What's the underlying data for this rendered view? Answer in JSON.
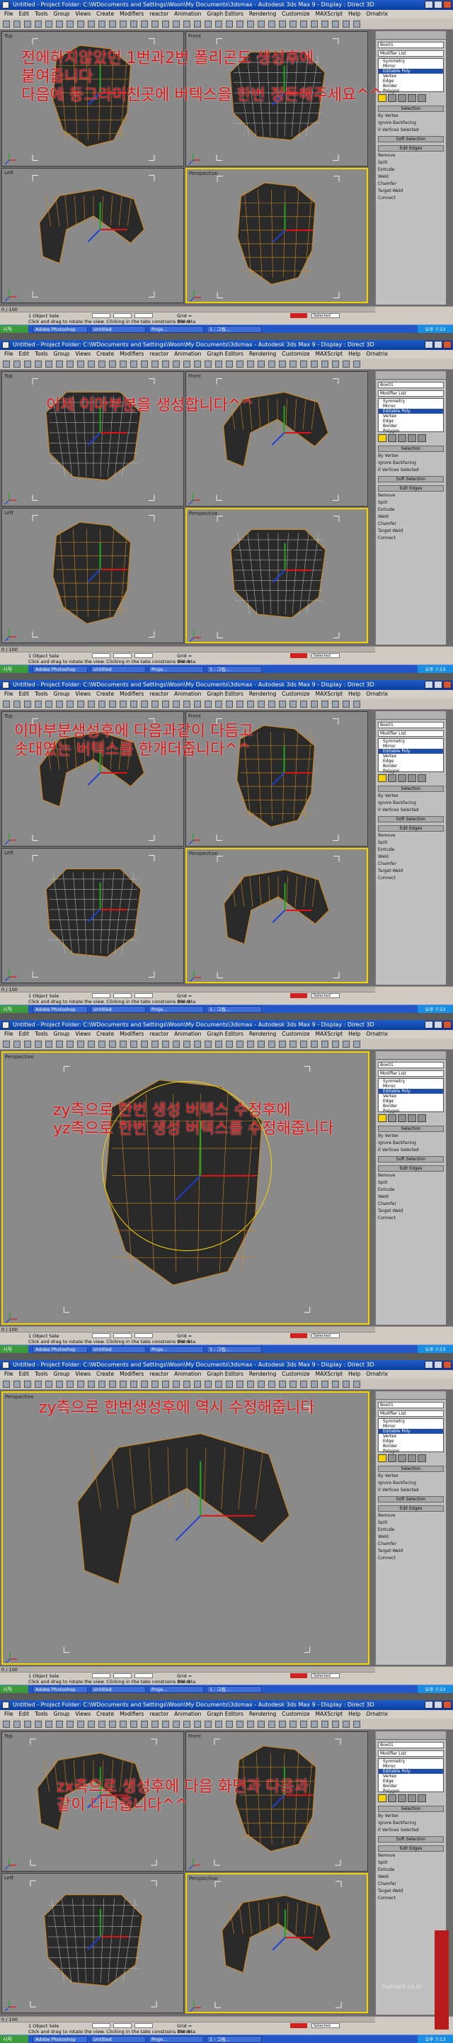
{
  "app": {
    "title": "Untitled    - Project Folder: C:\\WDocuments and Settings\\Woon\\My Documents\\3dsmax    - Autodesk 3ds Max 9     - Display : Direct 3D",
    "menu": [
      "File",
      "Edit",
      "Tools",
      "Group",
      "Views",
      "Create",
      "Modifiers",
      "reactor",
      "Animation",
      "Graph Editors",
      "Rendering",
      "Customize",
      "MAXScript",
      "Help",
      "Ornatrix"
    ]
  },
  "viewport_labels": [
    "Top",
    "Front",
    "Left",
    "Perspective"
  ],
  "panel": {
    "object_name": "Box01",
    "modifier_list": "Modifier List",
    "stack_items": [
      "Symmetry",
      "Mirror",
      "Editable Poly",
      "Vertex",
      "Edge",
      "Border",
      "Polygon"
    ],
    "selection_header": "Selection",
    "ignore_backfacing": "Ignore Backfacing",
    "by_vertex": "By Vertex",
    "vertices_selected": "0 Vertices Selected",
    "soft_selection": "Soft Selection",
    "edit_edges": "Edit Edges",
    "remove": "Remove",
    "extrude": "Extrude",
    "chamfer": "Chamfer",
    "split": "Split",
    "weld": "Weld",
    "target_weld": "Target Weld",
    "connect": "Connect"
  },
  "status": {
    "time": "0 / 100",
    "selected_count": "1 Object Sele",
    "hint": "Click and drag to rotate the view.  Clicking in the tabs constrains the rota",
    "render_time": "Rendering Time  0:00:01",
    "grid": "Grid = 100.0",
    "add_time_tag": "Add Time Tag",
    "auto_key": "Auto Key",
    "selected": "Selected",
    "set_key": "Set Key",
    "key_filters": "Key Filters..."
  },
  "taskbar": {
    "start": "시작",
    "tasks": [
      "Adobe Photoshop",
      "Untitled",
      "Proje...",
      "1 - 그림..."
    ],
    "clock": "오후 7:13"
  },
  "captions": [
    [
      "전에하지않았던 1번과2번 폴리곤도 생성후에",
      "붙여줍니다",
      "다음에 동그라미친곳에 버텍스을 한번 정돈해주세요^^"
    ],
    [
      "이제 이마부분을 생성합니다^^"
    ],
    [
      "이마부분생성후에 다음과같이 다듬고",
      "솟대였는 버텍스를 한개더줍니다^^"
    ],
    [
      "zy측으로 한번 생성 버텍스 수정후에",
      "yz측으로 한번 생성 버텍스를 수정해줍니다"
    ],
    [
      "zy측으로 한번생성후에 역시 수정해줍니다"
    ],
    [
      "zx측으로 생성후에 다음 화면과 다음과",
      "같이 다너줍니다^^"
    ]
  ],
  "watermark": "nuniart.co.kr",
  "colors": {
    "caption": "#e01414",
    "title_bar": "#0a3d9e",
    "viewport_bg": "#8a8a8a",
    "active_border": "#f5d400",
    "mesh_fill": "#2a2a2a",
    "mesh_edge": "#d48a1c",
    "gizmo_red": "#e01414",
    "gizmo_green": "#1fa81f",
    "gizmo_blue": "#1f3fd4"
  }
}
